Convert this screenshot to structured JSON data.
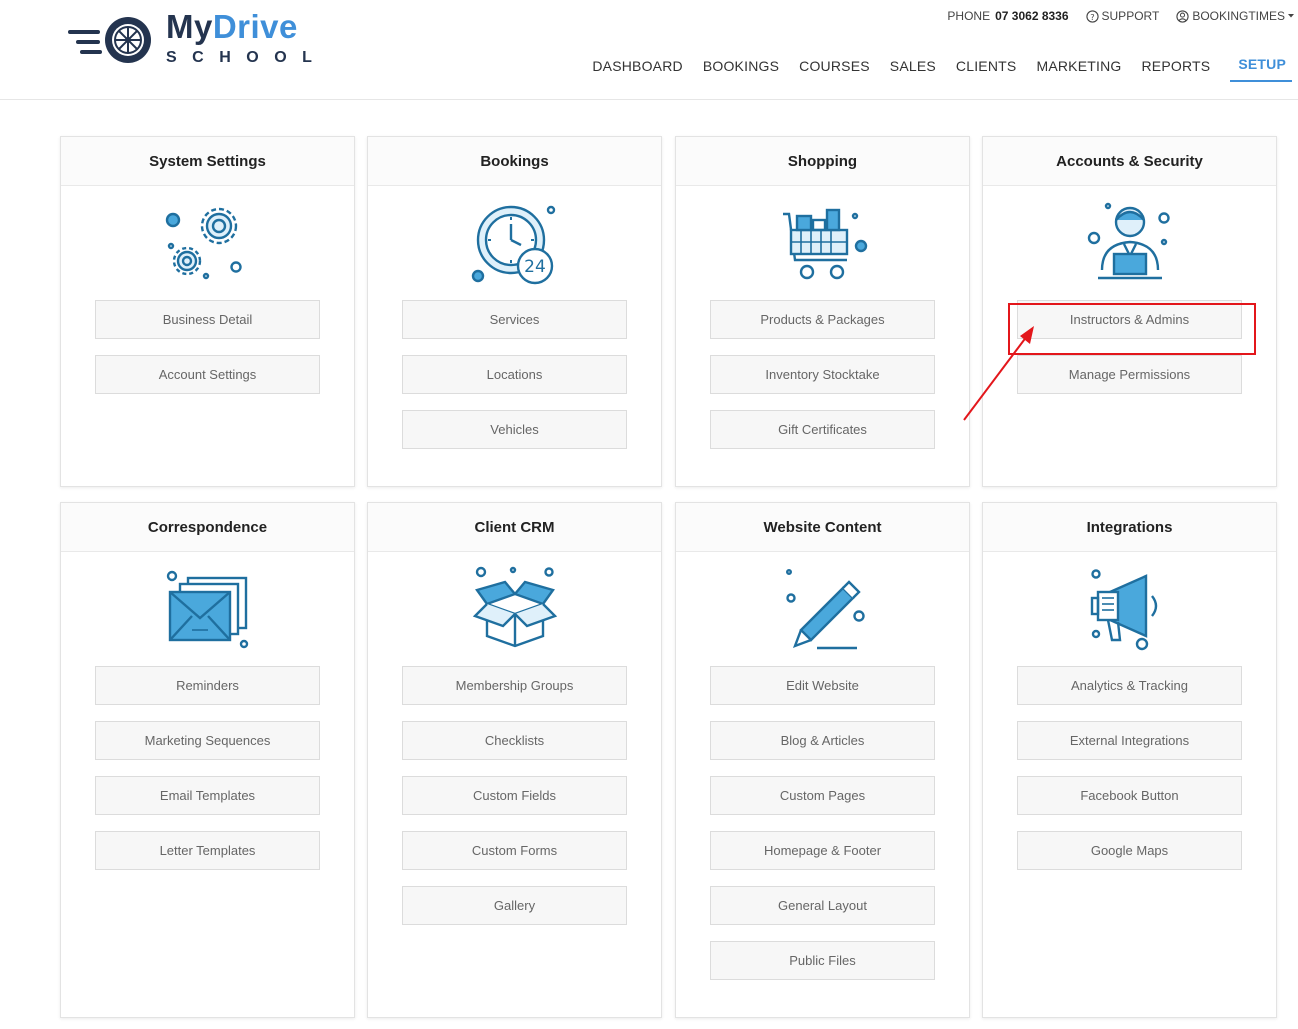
{
  "brand": {
    "name_my": "My",
    "name_drive": "Drive",
    "name_school": "SCHOOL"
  },
  "top_links": {
    "phone_label": "PHONE",
    "phone_number": "07 3062 8336",
    "support": "SUPPORT",
    "account": "BOOKINGTIMES"
  },
  "nav": [
    "DASHBOARD",
    "BOOKINGS",
    "COURSES",
    "SALES",
    "CLIENTS",
    "MARKETING",
    "REPORTS",
    "SETUP"
  ],
  "active_nav": "SETUP",
  "colors": {
    "accent": "#3f8fd9",
    "highlight": "#e3161b",
    "icon_stroke": "#1f6f9f",
    "icon_fill": "#4aa8dc"
  },
  "cards": [
    {
      "title": "System Settings",
      "icon": "gears-icon",
      "buttons": [
        "Business Detail",
        "Account Settings"
      ]
    },
    {
      "title": "Bookings",
      "icon": "clock-24-icon",
      "buttons": [
        "Services",
        "Locations",
        "Vehicles"
      ]
    },
    {
      "title": "Shopping",
      "icon": "shopping-cart-icon",
      "buttons": [
        "Products & Packages",
        "Inventory Stocktake",
        "Gift Certificates"
      ]
    },
    {
      "title": "Accounts & Security",
      "icon": "user-laptop-icon",
      "buttons": [
        "Instructors & Admins",
        "Manage Permissions"
      ]
    },
    {
      "title": "Correspondence",
      "icon": "envelopes-icon",
      "buttons": [
        "Reminders",
        "Marketing Sequences",
        "Email Templates",
        "Letter Templates"
      ]
    },
    {
      "title": "Client CRM",
      "icon": "open-box-icon",
      "buttons": [
        "Membership Groups",
        "Checklists",
        "Custom Fields",
        "Custom Forms",
        "Gallery"
      ]
    },
    {
      "title": "Website Content",
      "icon": "pencil-icon",
      "buttons": [
        "Edit Website",
        "Blog & Articles",
        "Custom Pages",
        "Homepage & Footer",
        "General Layout",
        "Public Files"
      ]
    },
    {
      "title": "Integrations",
      "icon": "megaphone-icon",
      "buttons": [
        "Analytics & Tracking",
        "External Integrations",
        "Facebook Button",
        "Google Maps"
      ]
    }
  ]
}
